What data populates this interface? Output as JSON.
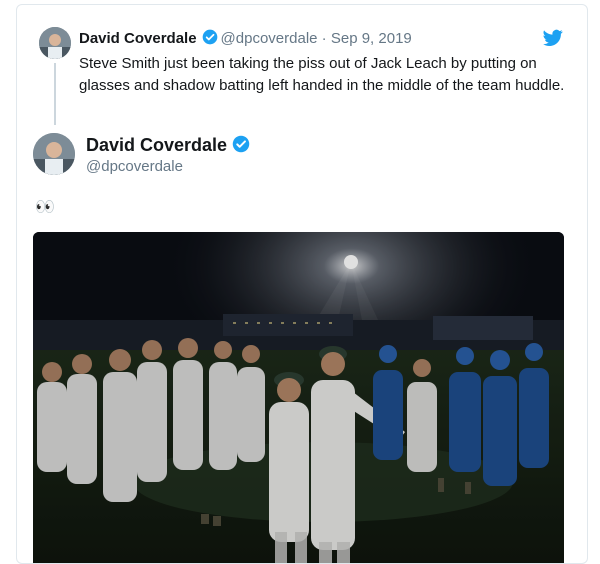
{
  "quoted_tweet": {
    "name": "David Coverdale",
    "handle": "@dpcoverdale",
    "separator": "·",
    "date": "Sep 9, 2019",
    "text": "Steve Smith just been taking the piss out of Jack Leach by putting on glasses and shadow batting left handed in the middle of the team huddle."
  },
  "main_tweet": {
    "name": "David Coverdale",
    "handle": "@dpcoverdale",
    "text": "👀"
  },
  "icons": {
    "verified": "verified-badge-icon",
    "brand": "twitter-bird-icon"
  },
  "colors": {
    "brand_blue": "#1da1f2",
    "text": "#14171a",
    "secondary": "#657786",
    "border": "#e1e8ed"
  }
}
